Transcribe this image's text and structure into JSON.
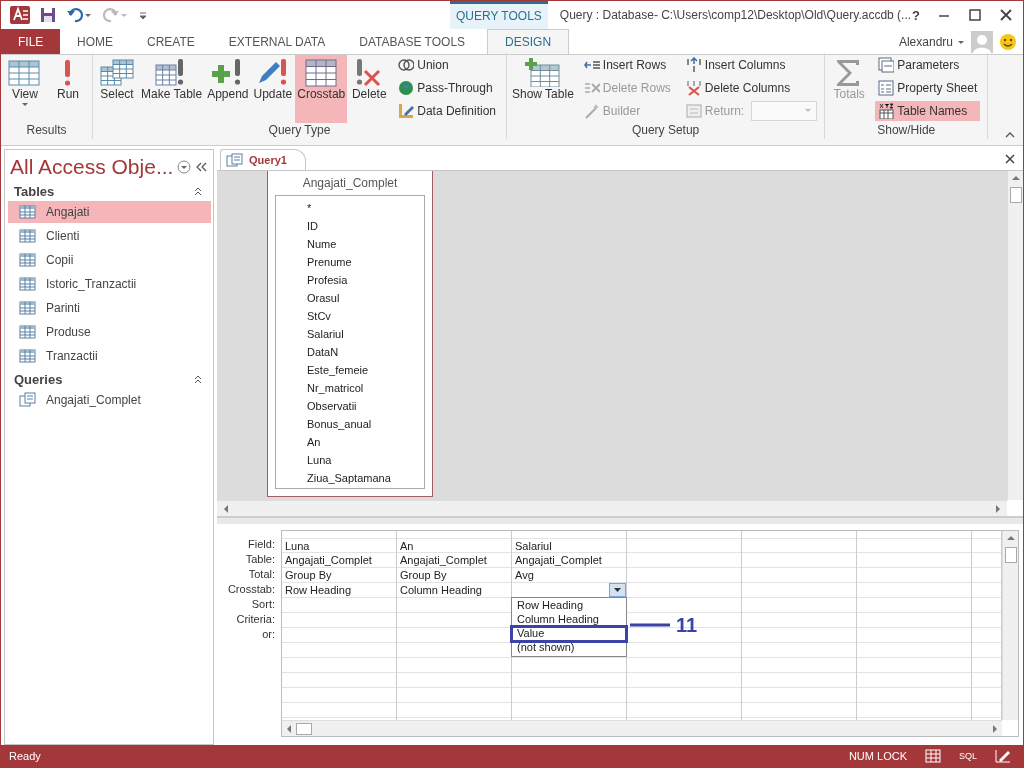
{
  "title_bar": {
    "contextual_tab": "QUERY TOOLS",
    "title": "Query : Database- C:\\Users\\comp12\\Desktop\\Old\\Query.accdb (...",
    "help": "?"
  },
  "ribbon_tabs": [
    {
      "label": "FILE",
      "kind": "file",
      "selected": false
    },
    {
      "label": "HOME",
      "kind": "tab",
      "selected": false
    },
    {
      "label": "CREATE",
      "kind": "tab",
      "selected": false
    },
    {
      "label": "EXTERNAL DATA",
      "kind": "tab",
      "selected": false
    },
    {
      "label": "DATABASE TOOLS",
      "kind": "tab",
      "selected": false
    },
    {
      "label": "DESIGN",
      "kind": "tab",
      "selected": true
    }
  ],
  "user": "Alexandru",
  "ribbon_groups": [
    {
      "label": "Results",
      "items": [
        {
          "kind": "large",
          "label": "View",
          "selected": false,
          "disabled": false,
          "menu": true
        },
        {
          "kind": "large",
          "label": "Run",
          "selected": false,
          "disabled": false,
          "menu": false
        }
      ]
    },
    {
      "label": "Query Type",
      "items": [
        {
          "kind": "large",
          "label": "Select",
          "selected": false,
          "disabled": false,
          "menu": false
        },
        {
          "kind": "large",
          "label": "Make Table",
          "selected": false,
          "disabled": false,
          "menu": false
        },
        {
          "kind": "large",
          "label": "Append",
          "selected": false,
          "disabled": false,
          "menu": false
        },
        {
          "kind": "large",
          "label": "Update",
          "selected": false,
          "disabled": false,
          "menu": false
        },
        {
          "kind": "large",
          "label": "Crosstab",
          "selected": true,
          "disabled": false,
          "menu": false
        },
        {
          "kind": "large",
          "label": "Delete",
          "selected": false,
          "disabled": false,
          "menu": false
        },
        {
          "kind": "stack",
          "buttons": [
            {
              "kind": "small",
              "label": "Union",
              "selected": false,
              "disabled": false
            },
            {
              "kind": "small",
              "label": "Pass-Through",
              "selected": false,
              "disabled": false
            },
            {
              "kind": "small",
              "label": "Data Definition",
              "selected": false,
              "disabled": false
            }
          ]
        }
      ]
    },
    {
      "label": "Query Setup",
      "items": [
        {
          "kind": "large",
          "label": "Show Table",
          "selected": false,
          "disabled": false,
          "menu": false
        },
        {
          "kind": "stack",
          "buttons": [
            {
              "kind": "small",
              "label": "Insert Rows",
              "selected": false,
              "disabled": false
            },
            {
              "kind": "small",
              "label": "Delete Rows",
              "selected": false,
              "disabled": true
            },
            {
              "kind": "small",
              "label": "Builder",
              "selected": false,
              "disabled": true
            }
          ]
        },
        {
          "kind": "stack",
          "buttons": [
            {
              "kind": "small",
              "label": "Insert Columns",
              "selected": false,
              "disabled": false
            },
            {
              "kind": "small",
              "label": "Delete Columns",
              "selected": false,
              "disabled": false
            },
            {
              "kind": "combo",
              "label": "Return:",
              "selected": false,
              "disabled": true
            }
          ]
        }
      ]
    },
    {
      "label": "Show/Hide",
      "items": [
        {
          "kind": "large",
          "label": "Totals",
          "selected": false,
          "disabled": true,
          "menu": false
        },
        {
          "kind": "stack",
          "buttons": [
            {
              "kind": "small",
              "label": "Parameters",
              "selected": false,
              "disabled": false
            },
            {
              "kind": "small",
              "label": "Property Sheet",
              "selected": false,
              "disabled": false
            },
            {
              "kind": "small",
              "label": "Table Names",
              "selected": true,
              "disabled": false
            }
          ]
        }
      ]
    }
  ],
  "nav_pane": {
    "title": "All Access Obje...",
    "groups": [
      {
        "label": "Tables",
        "kind": "table",
        "items": [
          {
            "label": "Angajati",
            "selected": true
          },
          {
            "label": "Clienti",
            "selected": false
          },
          {
            "label": "Copii",
            "selected": false
          },
          {
            "label": "Istoric_Tranzactii",
            "selected": false
          },
          {
            "label": "Parinti",
            "selected": false
          },
          {
            "label": "Produse",
            "selected": false
          },
          {
            "label": "Tranzactii",
            "selected": false
          }
        ]
      },
      {
        "label": "Queries",
        "kind": "query",
        "items": [
          {
            "label": "Angajati_Complet",
            "selected": false
          }
        ]
      }
    ]
  },
  "document_tab": {
    "label": "Query1",
    "selected": true
  },
  "field_list": {
    "title": "Angajati_Complet",
    "fields": [
      "*",
      "ID",
      "Nume",
      "Prenume",
      "Profesia",
      "Orasul",
      "StCv",
      "Salariul",
      "DataN",
      "Este_femeie",
      "Nr_matricol",
      "Observatii",
      "Bonus_anual",
      "An",
      "Luna",
      "Ziua_Saptamana"
    ]
  },
  "design_grid": {
    "row_labels": [
      "Field:",
      "Table:",
      "Total:",
      "Crosstab:",
      "Sort:",
      "Criteria:",
      "or:"
    ],
    "columns": [
      {
        "field": "Luna",
        "table": "Angajati_Complet",
        "total": "Group By",
        "crosstab": "Row Heading"
      },
      {
        "field": "An",
        "table": "Angajati_Complet",
        "total": "Group By",
        "crosstab": "Column Heading"
      },
      {
        "field": "Salariul",
        "table": "Angajati_Complet",
        "total": "Avg",
        "dropdown": {
          "options": [
            {
              "label": "Row Heading",
              "outlined": false
            },
            {
              "label": "Column Heading",
              "outlined": false
            },
            {
              "label": "Value",
              "outlined": true
            },
            {
              "label": "(not shown)",
              "outlined": false
            }
          ],
          "annotation": "11"
        }
      }
    ]
  },
  "status_bar": {
    "left": "Ready",
    "num_lock": "NUM LOCK",
    "sql": "SQL"
  }
}
